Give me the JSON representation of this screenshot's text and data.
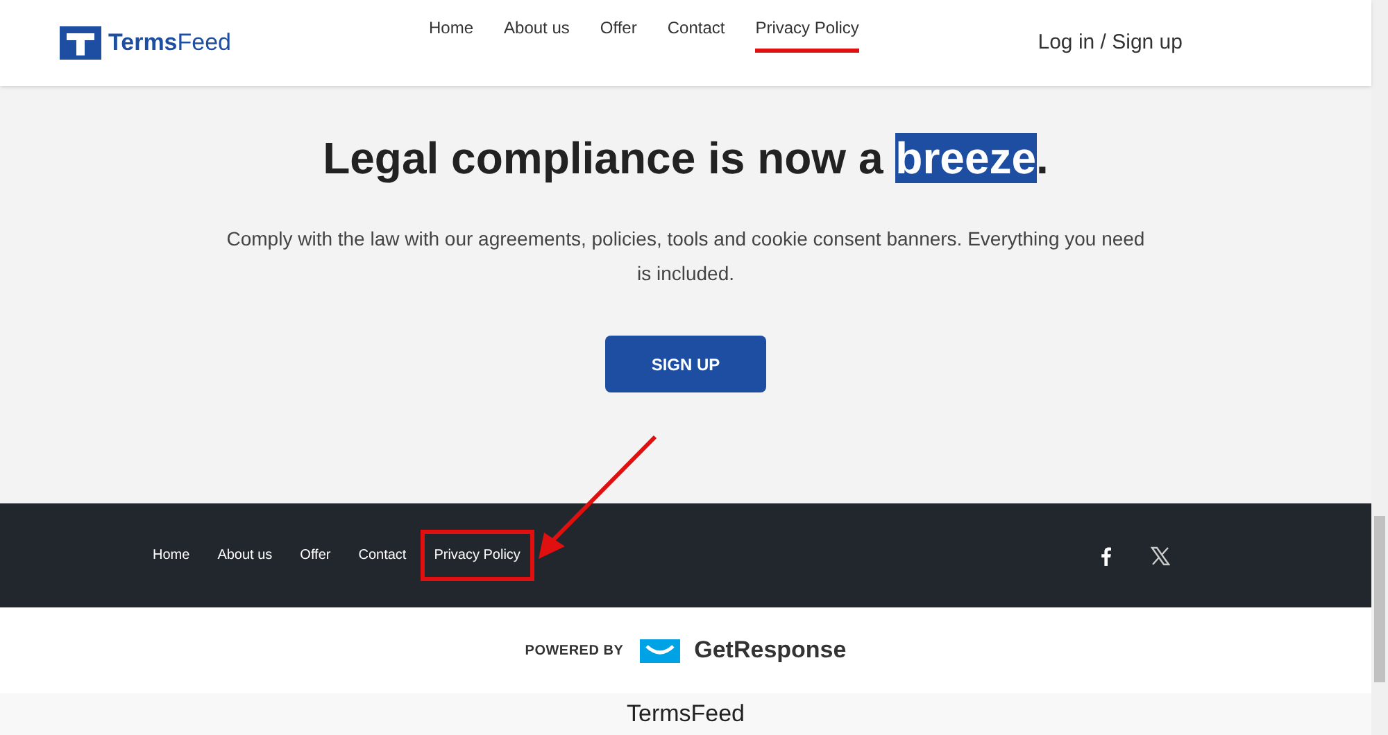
{
  "header": {
    "logo": {
      "strong": "Terms",
      "light": "Feed"
    },
    "nav": [
      {
        "label": "Home",
        "selected": false
      },
      {
        "label": "About us",
        "selected": false
      },
      {
        "label": "Offer",
        "selected": false
      },
      {
        "label": "Contact",
        "selected": false
      },
      {
        "label": "Privacy Policy",
        "selected": true
      }
    ],
    "login": "Log in / Sign up"
  },
  "hero": {
    "heading": [
      {
        "text": "Legal compliance is now a ",
        "highlighted": false
      },
      {
        "text": "breeze",
        "highlighted": true
      },
      {
        "text": ".",
        "highlighted": false
      }
    ],
    "text": "Comply with the law with our agreements, policies, tools and cookie consent banners. Everything you need is included.",
    "button": "SIGN UP"
  },
  "footer": {
    "links": [
      {
        "label": "Home",
        "highlighted": false
      },
      {
        "label": "About us",
        "highlighted": false
      },
      {
        "label": "Offer",
        "highlighted": false
      },
      {
        "label": "Contact",
        "highlighted": false
      },
      {
        "label": "Privacy Policy",
        "highlighted": true
      }
    ]
  },
  "powered": {
    "label": "POWERED BY",
    "brand": "GetResponse"
  },
  "caption": "TermsFeed"
}
